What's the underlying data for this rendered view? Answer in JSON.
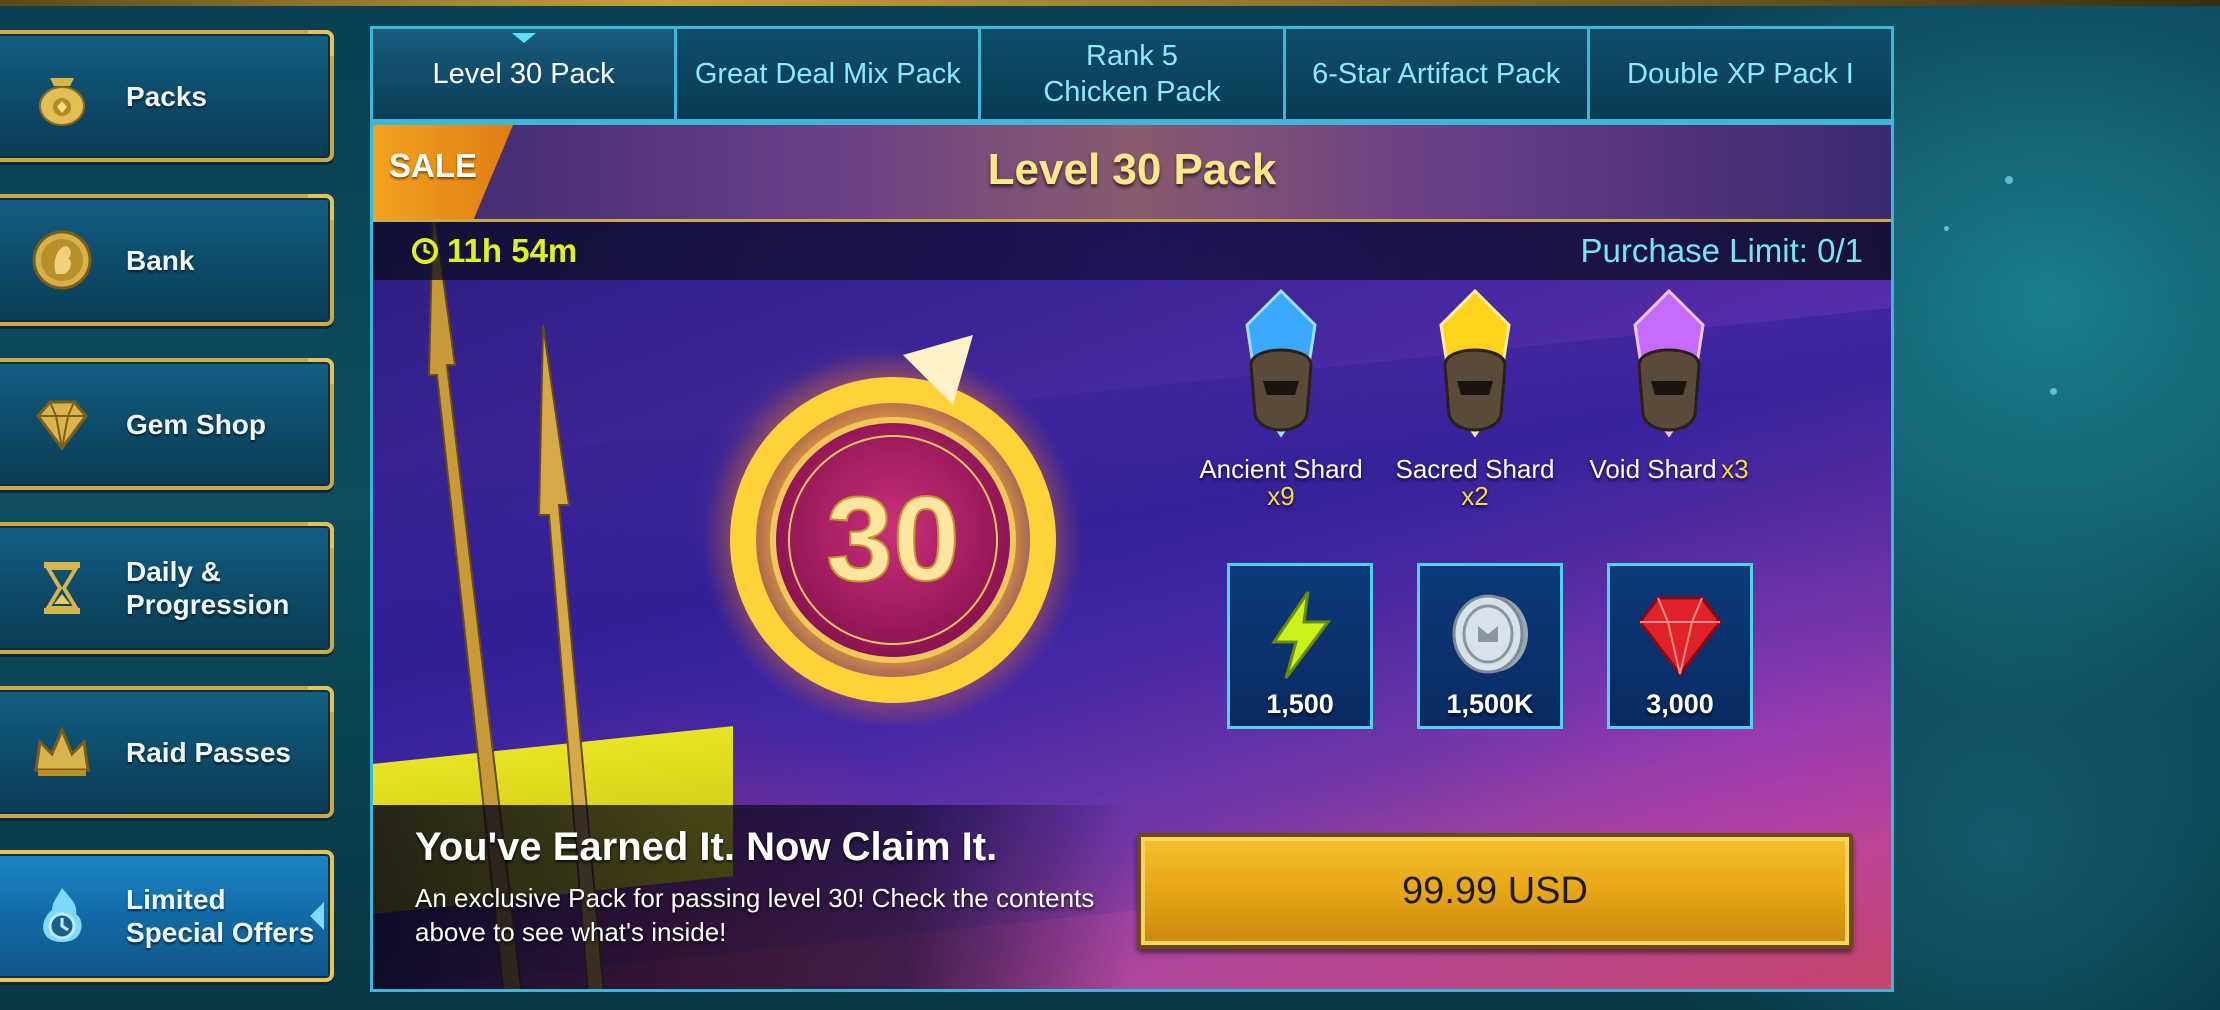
{
  "sidebar": {
    "items": [
      {
        "label": "Packs",
        "icon": "pack-bag-icon"
      },
      {
        "label": "Bank",
        "icon": "bank-coin-icon"
      },
      {
        "label": "Gem Shop",
        "icon": "gem-icon"
      },
      {
        "label": "Daily & Progression",
        "icon": "hourglass-icon"
      },
      {
        "label": "Raid Passes",
        "icon": "crown-icon"
      },
      {
        "label": "Limited Special Offers",
        "icon": "clock-flame-icon",
        "active": true
      }
    ]
  },
  "tabs": [
    {
      "label": "Level 30 Pack",
      "active": true
    },
    {
      "label": "Great Deal Mix Pack"
    },
    {
      "label": "Rank 5 Chicken Pack"
    },
    {
      "label": "6-Star Artifact Pack"
    },
    {
      "label": "Double XP Pack I"
    }
  ],
  "offer": {
    "sale_badge": "SALE",
    "title": "Level 30 Pack",
    "timer": "11h 54m",
    "purchase_limit": "Purchase Limit: 0/1",
    "emblem_number": "30",
    "shards": [
      {
        "name": "Ancient Shard",
        "qty": "x9",
        "color": "#3aa8ff"
      },
      {
        "name": "Sacred Shard",
        "qty": "x2",
        "color": "#ffd21c"
      },
      {
        "name": "Void Shard",
        "qty": "x3",
        "color": "#c66bff"
      }
    ],
    "rewards": [
      {
        "icon": "energy-bolt-icon",
        "amount": "1,500"
      },
      {
        "icon": "silver-coin-icon",
        "amount": "1,500K"
      },
      {
        "icon": "ruby-gem-icon",
        "amount": "3,000"
      }
    ],
    "tagline": "You've Earned It. Now Claim It.",
    "description": "An exclusive Pack for passing level 30! Check the contents above to see what's inside!",
    "price_label": "99.99 USD"
  },
  "colors": {
    "accent_gold": "#c9a94a",
    "tab_border": "#3fb6d8",
    "buy_button": "#e6a617"
  }
}
